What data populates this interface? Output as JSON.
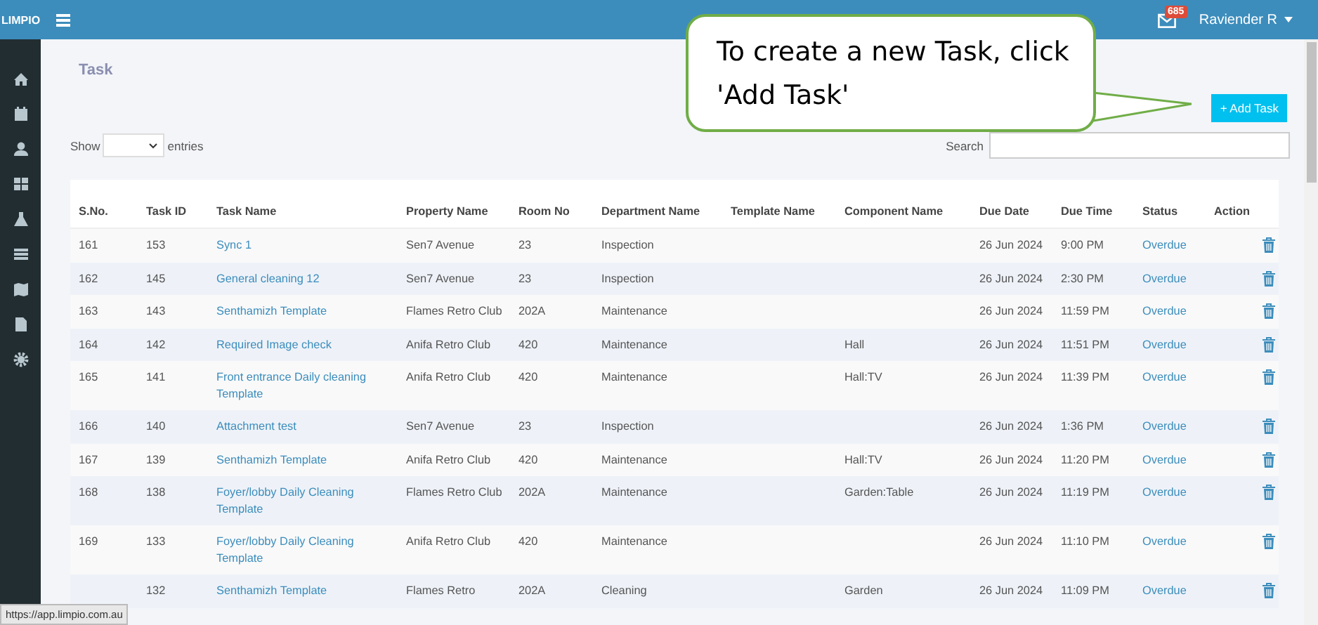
{
  "topbar": {
    "brand": "LIMPIO",
    "mail_badge": "685",
    "user": "Raviender R"
  },
  "page": {
    "title": "Task"
  },
  "callout": {
    "text": "To create a new Task, click 'Add Task'"
  },
  "add_button": {
    "label": "+ Add Task"
  },
  "length_control": {
    "before": "Show",
    "after": "entries"
  },
  "search": {
    "label": "Search"
  },
  "table": {
    "columns": [
      "S.No.",
      "Task ID",
      "Task Name",
      "Property Name",
      "Room No",
      "Department Name",
      "Template Name",
      "Component Name",
      "Due Date",
      "Due Time",
      "Status",
      "Action"
    ],
    "rows": [
      {
        "sno": "161",
        "task_id": "153",
        "task_name": "Sync 1",
        "property": "Sen7 Avenue",
        "room": "23",
        "department": "Inspection",
        "due_date": "26 Jun 2024",
        "due_time": "9:00 PM",
        "status": "Overdue"
      },
      {
        "sno": "162",
        "task_id": "145",
        "task_name": "General cleaning 12",
        "property": "Sen7 Avenue",
        "room": "23",
        "department": "Inspection",
        "due_date": "26 Jun 2024",
        "due_time": "2:30 PM",
        "status": "Overdue"
      },
      {
        "sno": "163",
        "task_id": "143",
        "task_name": "Senthamizh Template",
        "property": "Flames Retro Club",
        "room": "202A",
        "department": "Maintenance",
        "due_date": "26 Jun 2024",
        "due_time": "11:59 PM",
        "status": "Overdue"
      },
      {
        "sno": "164",
        "task_id": "142",
        "task_name": "Required Image check",
        "property": "Anifa Retro Club",
        "room": "420",
        "department": "Maintenance",
        "component": "Hall",
        "due_date": "26 Jun 2024",
        "due_time": "11:51 PM",
        "status": "Overdue"
      },
      {
        "sno": "165",
        "task_id": "141",
        "task_name": "Front entrance Daily cleaning Template",
        "property": "Anifa Retro Club",
        "room": "420",
        "department": "Maintenance",
        "component": "Hall:TV",
        "due_date": "26 Jun 2024",
        "due_time": "11:39 PM",
        "status": "Overdue"
      },
      {
        "sno": "166",
        "task_id": "140",
        "task_name": "Attachment test",
        "property": "Sen7 Avenue",
        "room": "23",
        "department": "Inspection",
        "due_date": "26 Jun 2024",
        "due_time": "1:36 PM",
        "status": "Overdue"
      },
      {
        "sno": "167",
        "task_id": "139",
        "task_name": "Senthamizh Template",
        "property": "Anifa Retro Club",
        "room": "420",
        "department": "Maintenance",
        "component": "Hall:TV",
        "due_date": "26 Jun 2024",
        "due_time": "11:20 PM",
        "status": "Overdue"
      },
      {
        "sno": "168",
        "task_id": "138",
        "task_name": "Foyer/lobby Daily Cleaning Template",
        "property": "Flames Retro Club",
        "room": "202A",
        "department": "Maintenance",
        "component": "Garden:Table",
        "due_date": "26 Jun 2024",
        "due_time": "11:19 PM",
        "status": "Overdue"
      },
      {
        "sno": "169",
        "task_id": "133",
        "task_name": "Foyer/lobby Daily Cleaning Template",
        "property": "Anifa Retro Club",
        "room": "420",
        "department": "Maintenance",
        "due_date": "26 Jun 2024",
        "due_time": "11:10 PM",
        "status": "Overdue"
      },
      {
        "task_id": "132",
        "task_name": "Senthamizh Template",
        "property": "Flames Retro",
        "room": "202A",
        "department": "Cleaning",
        "component": "Garden",
        "due_date": "26 Jun 2024",
        "due_time": "11:09 PM",
        "status": "Overdue"
      }
    ]
  },
  "status_url": "https://app.limpio.com.au"
}
